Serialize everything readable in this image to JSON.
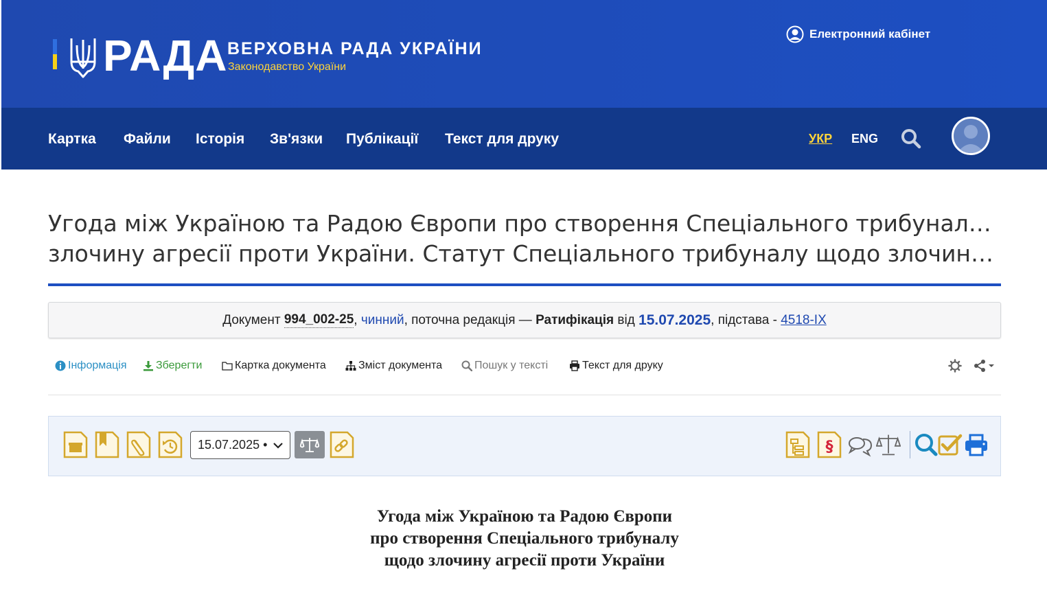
{
  "header": {
    "logo_word": "РАДА",
    "title": "ВЕРХОВНА РАДА УКРАЇНИ",
    "subtitle": "Законодавство України",
    "cabinet_label": "Електронний кабінет"
  },
  "nav": {
    "items": [
      "Картка",
      "Файли",
      "Історія",
      "Зв'язки",
      "Публікації",
      "Текст для друку"
    ],
    "lang_ukr": "УКР",
    "lang_eng": "ENG"
  },
  "document": {
    "heading_line1": "Угода між Україною та Радою Європи про створення Спеціального трибуналу щодо",
    "heading_line2": "злочину агресії проти України. Статут Спеціального трибуналу щодо злочину агресі…",
    "status": {
      "prefix": "Документ",
      "number": "994_002-25",
      "state": "чинний",
      "middle": ", поточна редакція —",
      "edition": "Ратифікація",
      "from": "від",
      "date": "15.07.2025",
      "basis_label": ", підстава -",
      "basis_link": "4518-IX"
    },
    "body_title": [
      "Угода між Україною та Радою Європи",
      "про створення Спеціального трибуналу",
      "щодо злочину агресії проти України"
    ]
  },
  "actions": {
    "info": "Інформація",
    "save": "Зберегти",
    "card": "Картка документа",
    "toc": "Зміст документа",
    "search": "Пошук у тексті",
    "print": "Текст для друку"
  },
  "toolbar": {
    "date_value": "15.07.2025 •"
  },
  "colors": {
    "header_blue": "#1d4fc2",
    "nav_blue": "#12398a",
    "accent_yellow": "#ffd43a",
    "icon_gold": "#d4a72c",
    "link_blue": "#1f49b0"
  }
}
